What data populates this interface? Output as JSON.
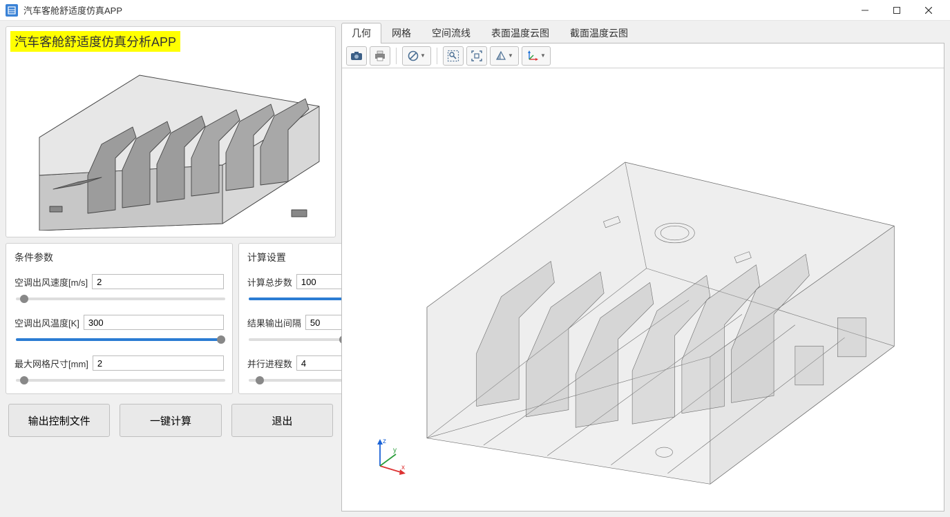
{
  "window": {
    "title": "汽车客舱舒适度仿真APP"
  },
  "preview": {
    "title": "汽车客舱舒适度仿真分析APP"
  },
  "left": {
    "conditions": {
      "legend": "条件参数",
      "wind_speed": {
        "label": "空调出风速度[m/s]",
        "value": "2"
      },
      "wind_temp": {
        "label": "空调出风温度[K]",
        "value": "300"
      },
      "mesh_size": {
        "label": "最大网格尺寸[mm]",
        "value": "2"
      }
    },
    "compute": {
      "legend": "计算设置",
      "total_steps": {
        "label": "计算总步数",
        "value": "100"
      },
      "output_every": {
        "label": "结果输出间隔",
        "value": "50"
      },
      "parallel_procs": {
        "label": "并行进程数",
        "value": "4"
      }
    },
    "buttons": {
      "output_control": "输出控制文件",
      "run": "一键计算",
      "exit": "退出"
    }
  },
  "viewer": {
    "tabs": {
      "geometry": "几何",
      "mesh": "网格",
      "streamlines": "空间流线",
      "surf_temp": "表面温度云图",
      "sect_temp": "截面温度云图"
    },
    "axes": {
      "x": "x",
      "y": "y",
      "z": "z"
    }
  }
}
